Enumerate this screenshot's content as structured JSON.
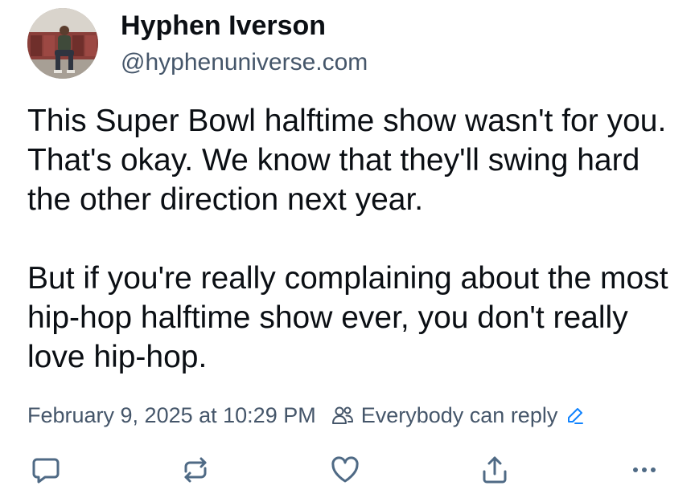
{
  "author": {
    "display_name": "Hyphen Iverson",
    "handle": "@hyphenuniverse.com"
  },
  "post": {
    "paragraphs": [
      "This Super Bowl halftime show wasn't for you. That's okay. We know that they'll swing hard the other direction next year.",
      "But if you're really complaining about the most hip-hop halftime show ever, you don't really love hip-hop."
    ],
    "timestamp": "February 9, 2025 at 10:29 PM",
    "reply_setting": "Everybody can reply"
  },
  "icons": {
    "meta": [
      "people-icon",
      "edit-icon"
    ],
    "actions": [
      "reply-icon",
      "repost-icon",
      "like-icon",
      "share-icon",
      "more-icon"
    ]
  },
  "colors": {
    "text": "#0b0f14",
    "muted": "#45566a",
    "accent": "#1083fe",
    "icon": "#4f6a85"
  }
}
